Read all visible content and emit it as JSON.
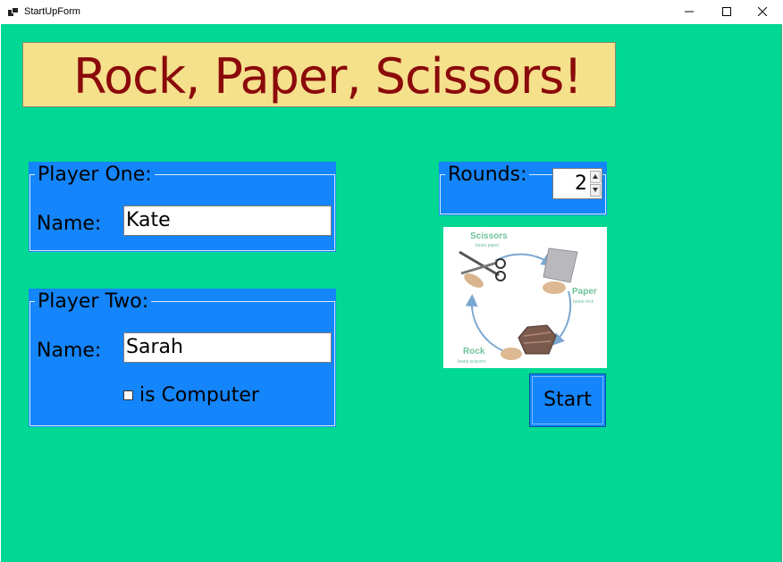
{
  "window": {
    "title": "StartUpForm",
    "icons": [
      "app-icon",
      "minimize-icon",
      "maximize-icon",
      "close-icon"
    ]
  },
  "banner": {
    "text": "Rock, Paper, Scissors!"
  },
  "player_one": {
    "legend": "Player One:",
    "name_label": "Name:",
    "name_value": "Kate"
  },
  "player_two": {
    "legend": "Player Two:",
    "name_label": "Name:",
    "name_value": "Sarah",
    "computer_label": "is Computer",
    "computer_checked": false
  },
  "rounds": {
    "legend": "Rounds:",
    "value": "2"
  },
  "diagram": {
    "scissors": "Scissors",
    "scissors_sub": "beats paper",
    "paper": "Paper",
    "paper_sub": "beats rock",
    "rock": "Rock",
    "rock_sub": "beats scissors"
  },
  "start": {
    "label": "Start"
  },
  "colors": {
    "form_bg": "#00d893",
    "group_bg": "#1485fb",
    "banner_bg": "#f5e08c",
    "banner_text": "#8b0a0a",
    "diagram_text": "#6fc29a",
    "diagram_arrow": "#7aa7d0"
  }
}
